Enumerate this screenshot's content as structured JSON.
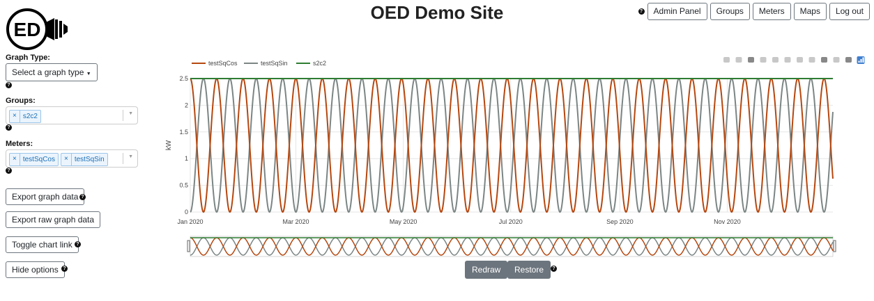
{
  "header": {
    "logo_text": "ED",
    "title": "OED Demo Site",
    "help_glyph": "?",
    "nav": [
      "Admin Panel",
      "Groups",
      "Meters",
      "Maps",
      "Log out"
    ]
  },
  "sidebar": {
    "graph_type_label": "Graph Type:",
    "graph_type_value": "Select a graph type",
    "groups_label": "Groups:",
    "groups_selected": [
      "s2c2"
    ],
    "meters_label": "Meters:",
    "meters_selected": [
      "testSqCos",
      "testSqSin"
    ],
    "remove_glyph": "×",
    "help_glyph": "?",
    "buttons": {
      "export_graph": "Export graph data",
      "export_raw": "Export raw graph data",
      "toggle_link": "Toggle chart link",
      "hide_options": "Hide options"
    }
  },
  "controls": {
    "redraw": "Redraw",
    "restore": "Restore",
    "help_glyph": "?"
  },
  "colors": {
    "testSqCos": "#b5470f",
    "testSqSin": "#7b8584",
    "s2c2": "#2e7d32"
  },
  "toolbar_icons": [
    "camera-icon",
    "save-icon",
    "zoom-icon",
    "pan-icon",
    "zoom-in-icon",
    "zoom-out-icon",
    "autoscale-icon",
    "reset-axes-icon",
    "spike-lines-icon",
    "hover-closest-icon",
    "hover-compare-icon",
    "plotly-logo-icon"
  ],
  "chart_data": {
    "type": "line",
    "ylabel": "kW",
    "ylim": [
      0,
      2.5
    ],
    "yticks": [
      0,
      0.5,
      1,
      1.5,
      2,
      2.5
    ],
    "x_range": [
      "2020-01-01",
      "2020-12-31"
    ],
    "xticks": [
      {
        "date": "2020-01-01",
        "label": "Jan 2020"
      },
      {
        "date": "2020-03-01",
        "label": "Mar 2020"
      },
      {
        "date": "2020-05-01",
        "label": "May 2020"
      },
      {
        "date": "2020-07-01",
        "label": "Jul 2020"
      },
      {
        "date": "2020-09-01",
        "label": "Sep 2020"
      },
      {
        "date": "2020-11-01",
        "label": "Nov 2020"
      }
    ],
    "legend": "top-left",
    "series": [
      {
        "name": "testSqCos",
        "function": "2.5*cos^2",
        "period_days": 15,
        "min": 0,
        "max": 2.5
      },
      {
        "name": "testSqSin",
        "function": "2.5*sin^2",
        "period_days": 15,
        "min": 0,
        "max": 2.5
      },
      {
        "name": "s2c2",
        "constant": 2.5
      }
    ]
  }
}
